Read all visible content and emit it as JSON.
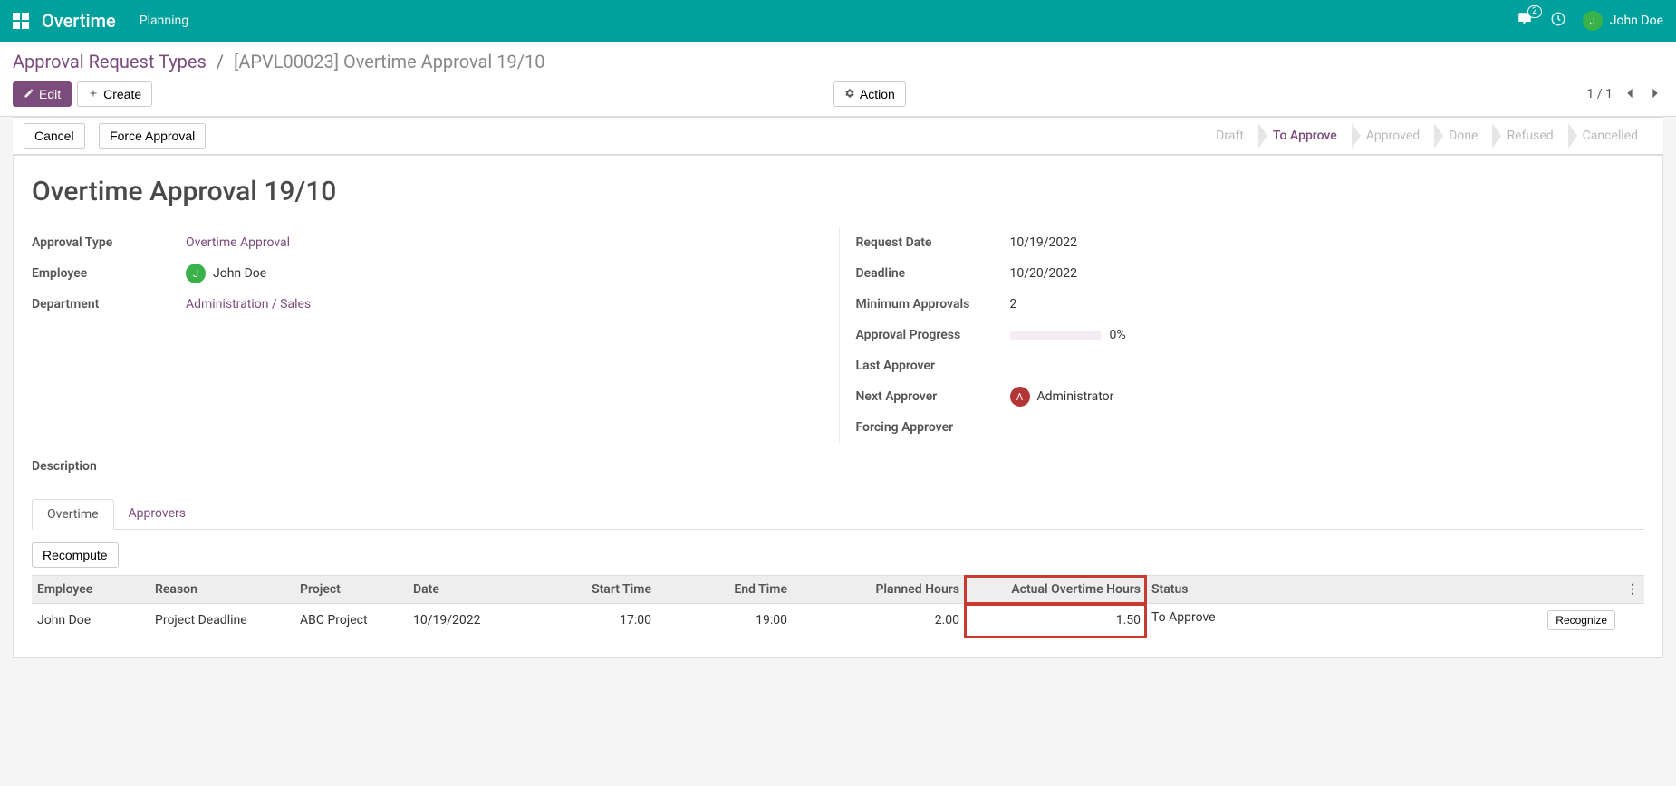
{
  "navbar": {
    "app_name": "Overtime",
    "menu_planning": "Planning",
    "chat_badge": "2",
    "user_initial": "J",
    "user_name": "John Doe"
  },
  "breadcrumb": {
    "root": "Approval Request Types",
    "current": "[APVL00023] Overtime Approval 19/10"
  },
  "buttons": {
    "edit": "Edit",
    "create": "Create",
    "action": "Action",
    "cancel": "Cancel",
    "force_approval": "Force Approval",
    "recompute": "Recompute",
    "recognize": "Recognize"
  },
  "pager": {
    "text": "1 / 1"
  },
  "status_steps": [
    "Draft",
    "To Approve",
    "Approved",
    "Done",
    "Refused",
    "Cancelled"
  ],
  "active_step_index": 1,
  "record": {
    "title": "Overtime Approval 19/10",
    "labels": {
      "approval_type": "Approval Type",
      "employee": "Employee",
      "department": "Department",
      "request_date": "Request Date",
      "deadline": "Deadline",
      "min_approvals": "Minimum Approvals",
      "approval_progress": "Approval Progress",
      "last_approver": "Last Approver",
      "next_approver": "Next Approver",
      "forcing_approver": "Forcing Approver",
      "description": "Description"
    },
    "approval_type": "Overtime Approval",
    "employee_initial": "J",
    "employee": "John Doe",
    "department": "Administration / Sales",
    "request_date": "10/19/2022",
    "deadline": "10/20/2022",
    "min_approvals": "2",
    "progress_pct": "0%",
    "next_approver_initial": "A",
    "next_approver": "Administrator"
  },
  "tabs": {
    "overtime": "Overtime",
    "approvers": "Approvers"
  },
  "table": {
    "headers": {
      "employee": "Employee",
      "reason": "Reason",
      "project": "Project",
      "date": "Date",
      "start_time": "Start Time",
      "end_time": "End Time",
      "planned_hours": "Planned Hours",
      "actual_hours": "Actual Overtime Hours",
      "status": "Status"
    },
    "row": {
      "employee": "John Doe",
      "reason": "Project Deadline",
      "project": "ABC Project",
      "date": "10/19/2022",
      "start_time": "17:00",
      "end_time": "19:00",
      "planned_hours": "2.00",
      "actual_hours": "1.50",
      "status": "To Approve"
    }
  }
}
